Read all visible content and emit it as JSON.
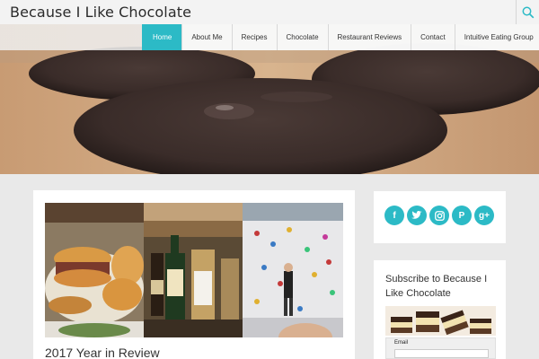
{
  "site": {
    "title": "Because I Like Chocolate"
  },
  "nav": {
    "items": [
      {
        "label": "Home",
        "active": true
      },
      {
        "label": "About Me",
        "active": false
      },
      {
        "label": "Recipes",
        "active": false
      },
      {
        "label": "Chocolate",
        "active": false
      },
      {
        "label": "Restaurant Reviews",
        "active": false
      },
      {
        "label": "Contact",
        "active": false
      },
      {
        "label": "Intuitive Eating Group",
        "active": false
      }
    ]
  },
  "search": {
    "icon": "search-icon"
  },
  "hero": {
    "image": "chocolate-cookies"
  },
  "post": {
    "title": "2017 Year in Review"
  },
  "social": {
    "icons": [
      "facebook-icon",
      "twitter-icon",
      "instagram-icon",
      "pinterest-icon",
      "google-plus-icon"
    ],
    "color": "#2cbac6"
  },
  "subscribe": {
    "title": "Subscribe to Because I Like Chocolate",
    "email_label": "Email"
  },
  "colors": {
    "accent": "#2cbac6",
    "background": "#e9e9e9"
  }
}
